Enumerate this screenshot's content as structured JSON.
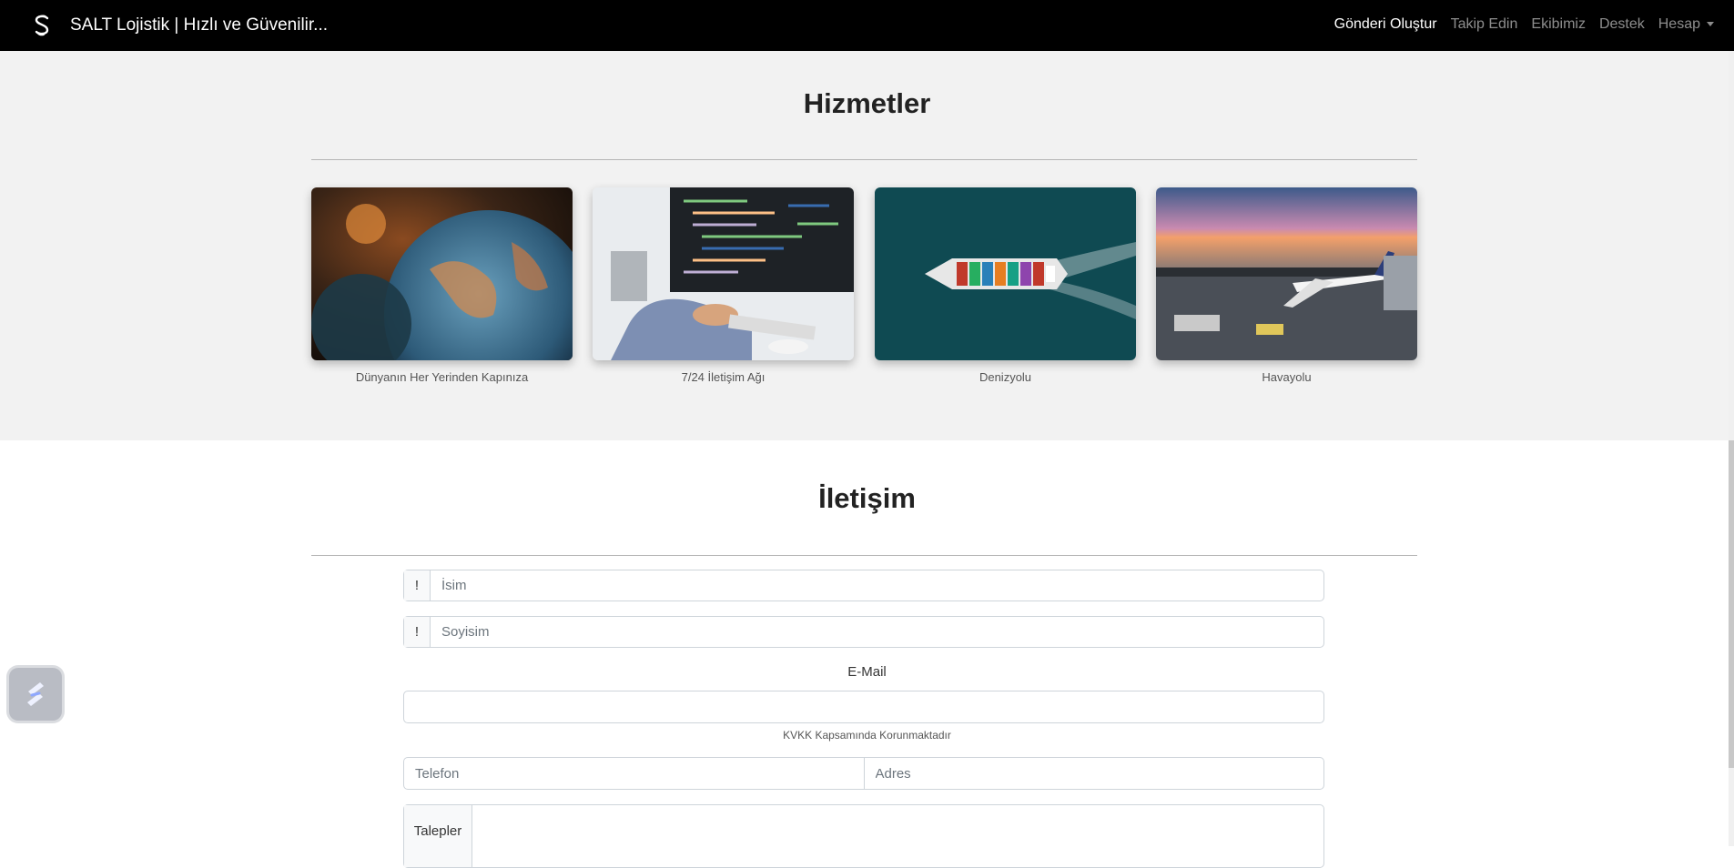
{
  "navbar": {
    "logo_icon": "salt-logo-icon",
    "brand": "SALT Lojistik | Hızlı ve Güvenilir...",
    "links": [
      {
        "label": "Gönderi Oluştur"
      },
      {
        "label": "Takip Edin"
      },
      {
        "label": "Ekibimiz"
      },
      {
        "label": "Destek"
      },
      {
        "label": "Hesap"
      }
    ]
  },
  "services": {
    "title": "Hizmetler",
    "cards": [
      {
        "caption": "Dünyanın Her Yerinden Kapınıza",
        "image": "globe-photo"
      },
      {
        "caption": "7/24 İletişim Ağı",
        "image": "computer-code-photo"
      },
      {
        "caption": "Denizyolu",
        "image": "cargo-ship-photo"
      },
      {
        "caption": "Havayolu",
        "image": "airplane-photo"
      }
    ]
  },
  "contact": {
    "title": "İletişim",
    "name_prefix": "!",
    "name_placeholder": "İsim",
    "surname_prefix": "!",
    "surname_placeholder": "Soyisim",
    "email_label": "E-Mail",
    "email_value": "",
    "email_help": "KVKK Kapsamında Korunmaktadır",
    "phone_placeholder": "Telefon",
    "address_placeholder": "Adres",
    "requests_label": "Talepler"
  },
  "floating_button": {
    "icon": "app-shortcut-icon"
  },
  "colors": {
    "navbar_bg": "#000000",
    "services_bg": "#f2f2f2",
    "contact_bg": "#ffffff"
  }
}
